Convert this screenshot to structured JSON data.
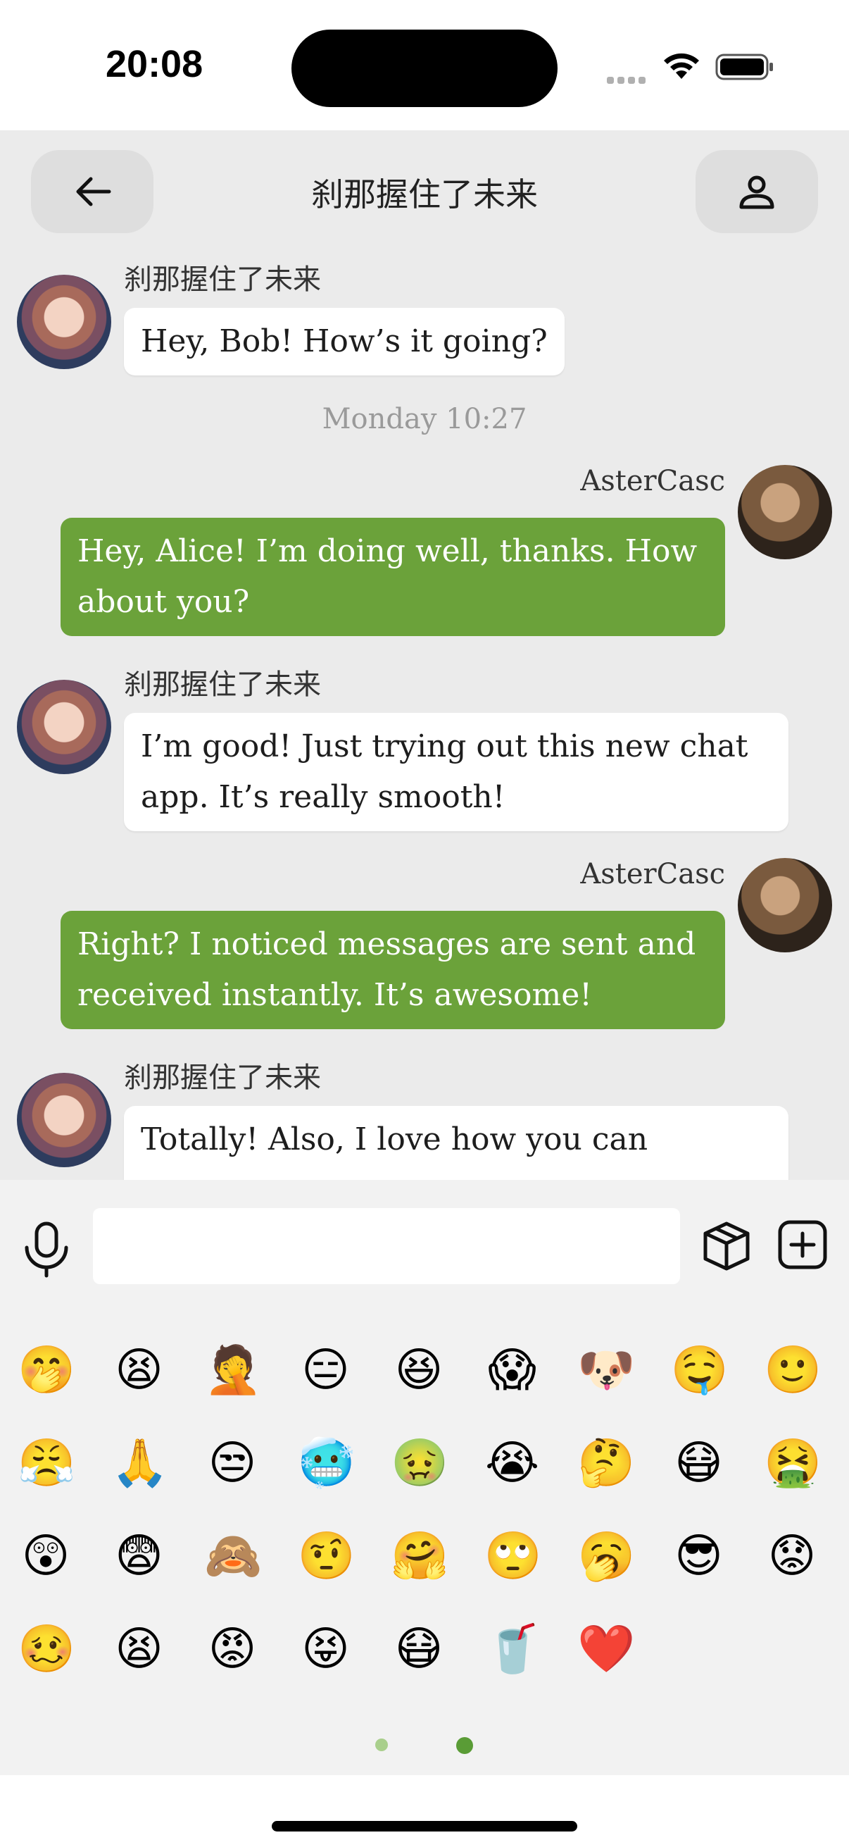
{
  "status_bar": {
    "time": "20:08"
  },
  "header": {
    "title": "刹那握住了未来",
    "back_icon": "arrow-left-icon",
    "profile_icon": "person-icon"
  },
  "messages": [
    {
      "sender": "刹那握住了未来",
      "direction": "incoming",
      "text": "Hey, Bob! How’s it going?"
    },
    {
      "timestamp": "Monday 10:27"
    },
    {
      "sender": "AsterCasc",
      "direction": "outgoing",
      "text": "Hey, Alice! I’m doing well, thanks. How about you?"
    },
    {
      "sender": "刹那握住了未来",
      "direction": "incoming",
      "text": "I’m good! Just trying out this new chat app. It’s really smooth!"
    },
    {
      "sender": "AsterCasc",
      "direction": "outgoing",
      "text": "Right? I noticed messages are sent and received instantly. It’s awesome!"
    },
    {
      "sender": "刹那握住了未来",
      "direction": "incoming",
      "text": "Totally! Also, I love how you can"
    }
  ],
  "input": {
    "value": "",
    "placeholder": ""
  },
  "emojis": [
    "🤭",
    "😫",
    "🤦",
    "😑",
    "😆",
    "😱",
    "🐶",
    "🤤",
    "🙂",
    "😤",
    "🙏",
    "😒",
    "🥶",
    "🤢",
    "😭",
    "🤔",
    "😷",
    "🤮",
    "😲",
    "😨",
    "🙈",
    "🤨",
    "🤗",
    "🙄",
    "🥱",
    "😎",
    "😟",
    "🥴",
    "😫",
    "😡",
    "😝",
    "😷",
    "🥤",
    "❤️"
  ],
  "colors": {
    "outgoing_bubble": "#6ba23a",
    "incoming_bubble": "#ffffff",
    "background": "#ebebeb",
    "accent": "#5a9c36"
  },
  "pager": {
    "pages": 2,
    "current": 2
  }
}
